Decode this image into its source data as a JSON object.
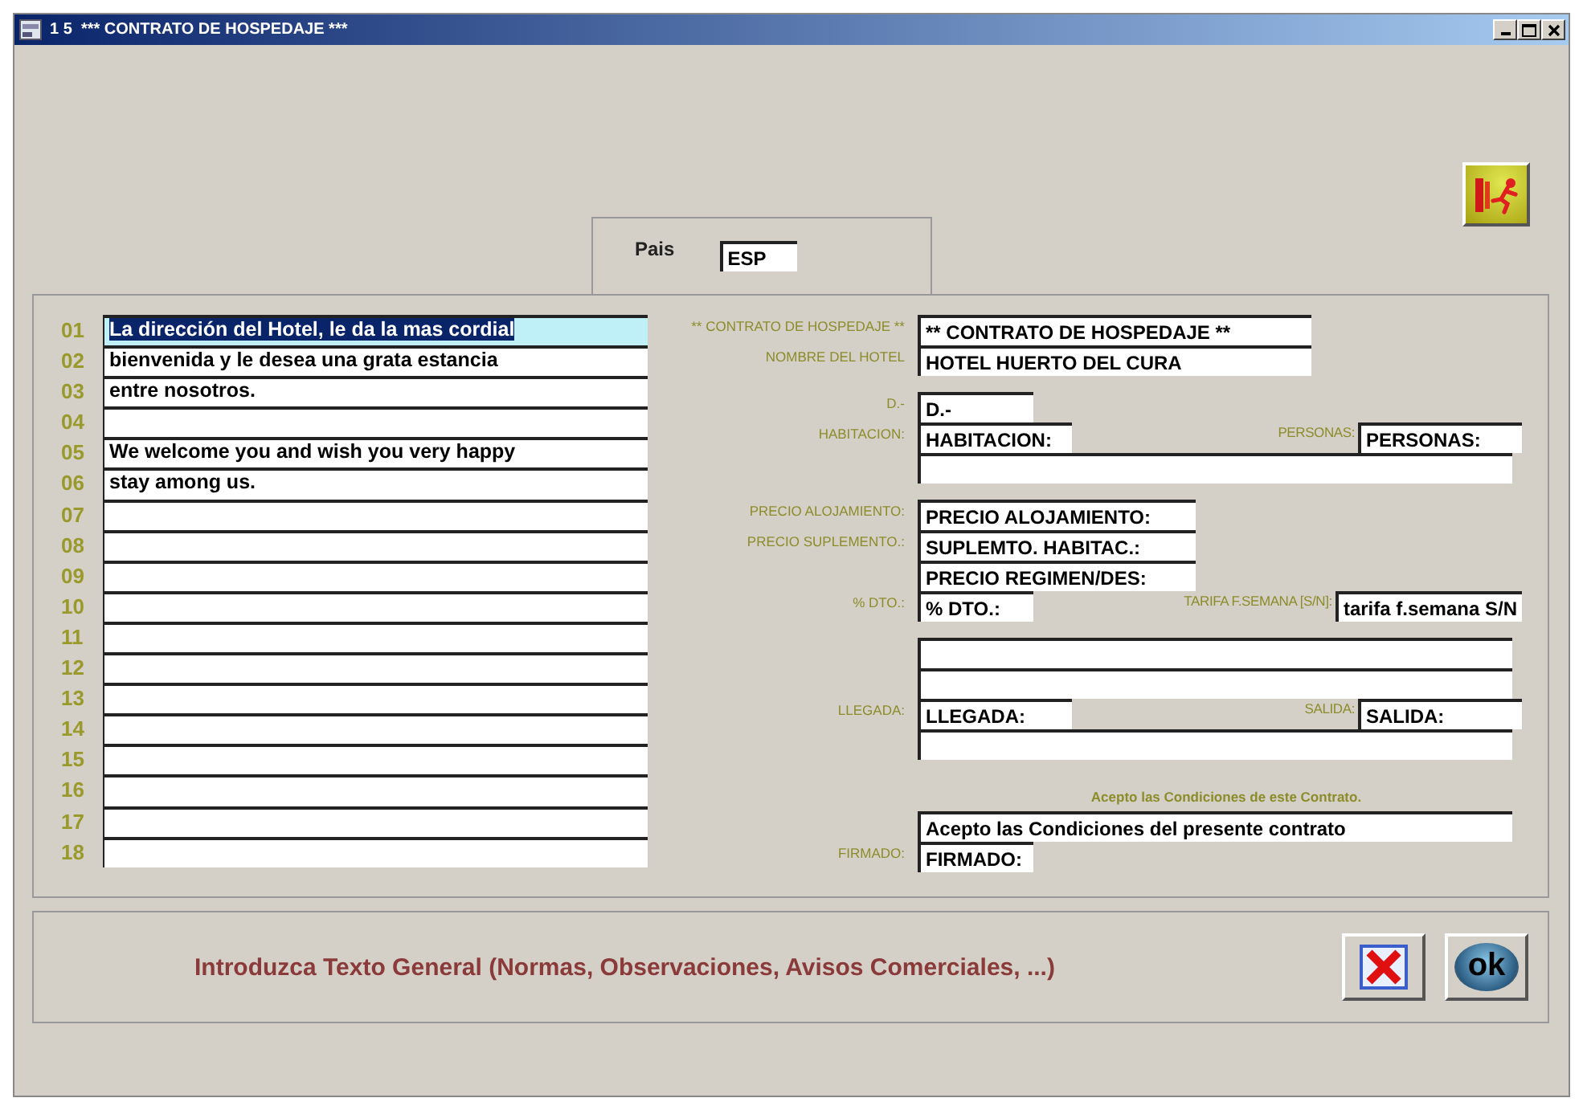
{
  "window": {
    "title": "1 5  *** CONTRATO DE HOSPEDAJE ***"
  },
  "country": {
    "label": "Pais",
    "value": "ESP"
  },
  "text_lines": [
    {
      "number": "01",
      "text": "La dirección del Hotel, le da la mas cordial",
      "selected": true
    },
    {
      "number": "02",
      "text": "bienvenida y le desea una grata estancia",
      "selected": false
    },
    {
      "number": "03",
      "text": "entre nosotros.",
      "selected": false
    },
    {
      "number": "04",
      "selected": false
    },
    {
      "number": "05",
      "text": "We welcome you and wish you very happy",
      "selected": false
    },
    {
      "number": "06",
      "text": "stay among us.",
      "selected": false
    },
    {
      "number": "07",
      "selected": false
    },
    {
      "number": "08",
      "selected": false
    },
    {
      "number": "09",
      "selected": false
    },
    {
      "number": "10",
      "selected": false
    },
    {
      "number": "11",
      "selected": false
    },
    {
      "number": "12",
      "selected": false
    },
    {
      "number": "13",
      "selected": false
    },
    {
      "number": "14",
      "selected": false
    },
    {
      "number": "15",
      "selected": false
    },
    {
      "number": "16",
      "selected": false
    },
    {
      "number": "17",
      "selected": false
    },
    {
      "number": "18",
      "selected": false
    }
  ],
  "form_rows": [
    {
      "fields": [
        {
          "label": "** CONTRATO DE HOSPEDAJE **",
          "value": "** CONTRATO DE HOSPEDAJE **",
          "kind": "wide"
        }
      ]
    },
    {
      "fields": [
        {
          "label": "NOMBRE DEL HOTEL",
          "value": "HOTEL HUERTO DEL CURA",
          "kind": "wide"
        }
      ]
    },
    {
      "fields": [
        {
          "label": "D.-",
          "value": "D.-",
          "kind": "tiny"
        }
      ]
    },
    {
      "fields": [
        {
          "label": "HABITACION:",
          "value": "HABITACION:",
          "kind": "small"
        },
        {
          "label": "PERSONAS:",
          "value": "PERSONAS:",
          "kind": "end"
        }
      ]
    },
    {
      "fields": [
        {
          "kind": "full"
        }
      ]
    },
    {
      "fields": [
        {
          "label": "PRECIO ALOJAMIENTO:",
          "value": "PRECIO ALOJAMIENTO:",
          "kind": "medium"
        }
      ]
    },
    {
      "fields": [
        {
          "label": "PRECIO SUPLEMENTO.:",
          "value": "SUPLEMTO. HABITAC.:",
          "kind": "medium"
        }
      ]
    },
    {
      "fields": [
        {
          "value": "PRECIO REGIMEN/DES:",
          "kind": "medium"
        }
      ]
    },
    {
      "fields": [
        {
          "label": "% DTO.:",
          "value": "% DTO.:",
          "kind": "tiny"
        },
        {
          "label": "TARIFA F.SEMANA [S/N]:",
          "value": "tarifa f.semana S/N",
          "kind": "end"
        }
      ]
    },
    {
      "fields": [
        {
          "kind": "full"
        }
      ]
    },
    {
      "fields": [
        {
          "kind": "full"
        }
      ]
    },
    {
      "fields": [
        {
          "label": "LLEGADA:",
          "value": "LLEGADA:",
          "kind": "small"
        },
        {
          "label": "SALIDA:",
          "value": "SALIDA:",
          "kind": "end"
        }
      ]
    },
    {
      "fields": [
        {
          "kind": "full"
        }
      ]
    },
    {
      "caption": "Acepto las Condiciones de este Contrato."
    },
    {
      "fields": [
        {
          "value": "Acepto las Condiciones del presente contrato",
          "kind": "full"
        }
      ]
    },
    {
      "fields": [
        {
          "label": "FIRMADO:",
          "value": "FIRMADO:",
          "kind": "tiny"
        }
      ]
    }
  ],
  "footer": {
    "message": "Introduzca Texto General (Normas, Observaciones, Avisos Comerciales, ...)",
    "ok_label": "ok"
  }
}
